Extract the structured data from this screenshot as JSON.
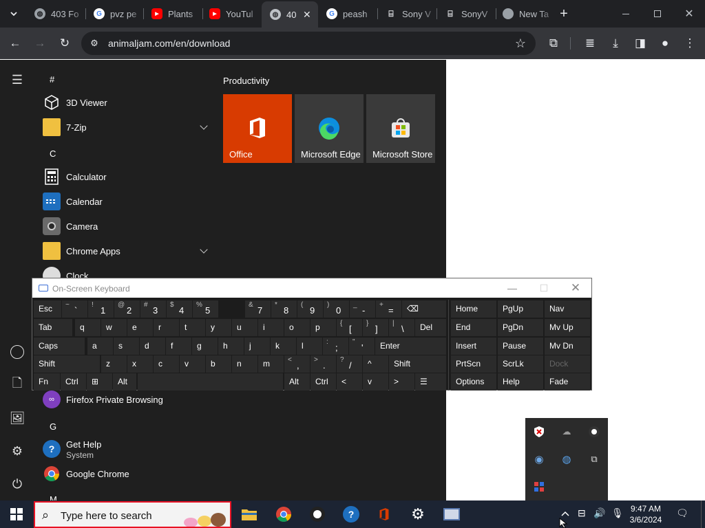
{
  "browser": {
    "tabs": [
      {
        "title": "403 Fo",
        "favicon": "globe-icon"
      },
      {
        "title": "pvz pe",
        "favicon": "google-icon"
      },
      {
        "title": "Plants",
        "favicon": "youtube-icon"
      },
      {
        "title": "YouTul",
        "favicon": "youtube-icon"
      },
      {
        "title": "40",
        "favicon": "globe-icon",
        "active": true
      },
      {
        "title": "peash",
        "favicon": "google-icon"
      },
      {
        "title": "Sony V",
        "favicon": "sony-icon"
      },
      {
        "title": "SonyV",
        "favicon": "sony-icon"
      },
      {
        "title": "New Ta",
        "favicon": "chrome-icon"
      }
    ],
    "url": "animaljam.com/en/download"
  },
  "start_menu": {
    "letters": {
      "hash": "#",
      "c": "C",
      "g": "G",
      "m": "M"
    },
    "apps": {
      "viewer3d": "3D Viewer",
      "zip": "7-Zip",
      "calculator": "Calculator",
      "calendar": "Calendar",
      "camera": "Camera",
      "chrome_apps": "Chrome Apps",
      "clock": "Clock",
      "firefox_private": "Firefox Private Browsing",
      "get_help": "Get Help",
      "get_help_sub": "System",
      "google_chrome": "Google Chrome"
    },
    "group_title": "Productivity",
    "tiles": {
      "office": "Office",
      "edge": "Microsoft Edge",
      "store": "Microsoft Store"
    }
  },
  "osk": {
    "title": "On-Screen Keyboard",
    "rows": [
      [
        {
          "m": "Esc"
        },
        {
          "s": "~",
          "m": "`"
        },
        {
          "s": "!",
          "m": "1"
        },
        {
          "s": "@",
          "m": "2"
        },
        {
          "s": "#",
          "m": "3"
        },
        {
          "s": "$",
          "m": "4"
        },
        {
          "s": "%",
          "m": "5"
        },
        {
          "s": "&",
          "m": "7"
        },
        {
          "s": "*",
          "m": "8"
        },
        {
          "s": "(",
          "m": "9"
        },
        {
          "s": ")",
          "m": "0"
        },
        {
          "s": "_",
          "m": "-"
        },
        {
          "s": "+",
          "m": "="
        },
        {
          "m": "⌫"
        },
        {
          "m": "Home"
        },
        {
          "m": "PgUp"
        },
        {
          "m": "Nav"
        }
      ],
      [
        {
          "m": "Tab"
        },
        {
          "m": "q"
        },
        {
          "m": "w"
        },
        {
          "m": "e"
        },
        {
          "m": "r"
        },
        {
          "m": "t"
        },
        {
          "m": "y"
        },
        {
          "m": "u"
        },
        {
          "m": "i"
        },
        {
          "m": "o"
        },
        {
          "m": "p"
        },
        {
          "s": "{",
          "m": "["
        },
        {
          "s": "}",
          "m": "]"
        },
        {
          "s": "|",
          "m": "\\"
        },
        {
          "m": "Del"
        },
        {
          "m": "End"
        },
        {
          "m": "PgDn"
        },
        {
          "m": "Mv Up"
        }
      ],
      [
        {
          "m": "Caps"
        },
        {
          "m": "a"
        },
        {
          "m": "s"
        },
        {
          "m": "d"
        },
        {
          "m": "f"
        },
        {
          "m": "g"
        },
        {
          "m": "h"
        },
        {
          "m": "j"
        },
        {
          "m": "k"
        },
        {
          "m": "l"
        },
        {
          "s": ":",
          "m": ";"
        },
        {
          "s": "\"",
          "m": "'"
        },
        {
          "m": "Enter"
        },
        {
          "m": "Insert"
        },
        {
          "m": "Pause"
        },
        {
          "m": "Mv Dn"
        }
      ],
      [
        {
          "m": "Shift"
        },
        {
          "m": "z"
        },
        {
          "m": "x"
        },
        {
          "m": "c"
        },
        {
          "m": "v"
        },
        {
          "m": "b"
        },
        {
          "m": "n"
        },
        {
          "m": "m"
        },
        {
          "s": "<",
          "m": ","
        },
        {
          "s": ">",
          "m": "."
        },
        {
          "s": "?",
          "m": "/"
        },
        {
          "m": "^"
        },
        {
          "m": "Shift"
        },
        {
          "m": "PrtScn"
        },
        {
          "m": "ScrLk"
        },
        {
          "m": "Dock"
        }
      ],
      [
        {
          "m": "Fn"
        },
        {
          "m": "Ctrl"
        },
        {
          "m": "⊞"
        },
        {
          "m": "Alt"
        },
        {
          "m": ""
        },
        {
          "m": "Alt"
        },
        {
          "m": "Ctrl"
        },
        {
          "m": "<"
        },
        {
          "m": "v"
        },
        {
          "m": ">"
        },
        {
          "m": "☰"
        },
        {
          "m": "Options"
        },
        {
          "m": "Help"
        },
        {
          "m": "Fade"
        }
      ]
    ]
  },
  "taskbar": {
    "search_placeholder": "Type here to search",
    "time": "9:47 AM",
    "date": "3/6/2024"
  },
  "colors": {
    "office_tile": "#d83b01",
    "search_border": "#e81123",
    "taskbar": "#1c2433"
  }
}
